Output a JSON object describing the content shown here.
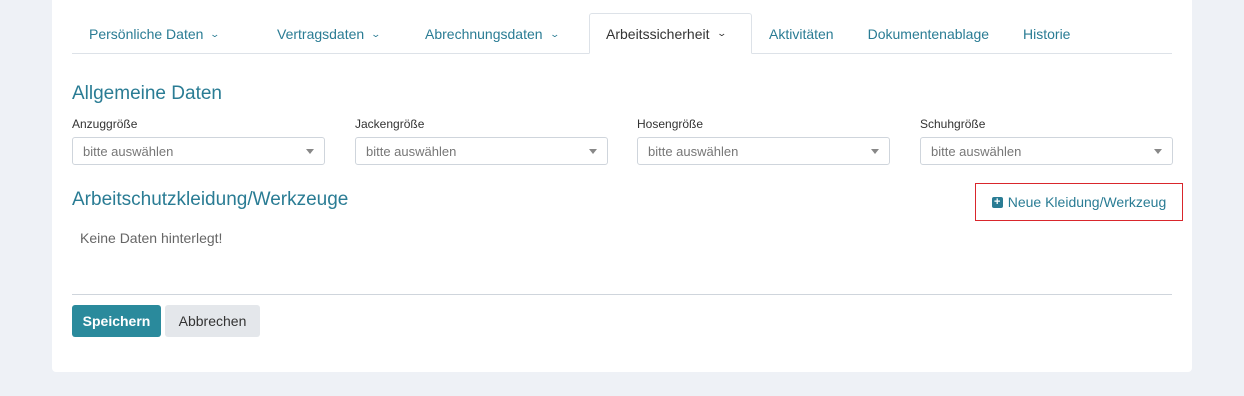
{
  "tabs": [
    {
      "label": "Persönliche Daten",
      "has_dropdown": true,
      "active": false
    },
    {
      "label": "Vertragsdaten",
      "has_dropdown": true,
      "active": false
    },
    {
      "label": "Abrechnungsdaten",
      "has_dropdown": true,
      "active": false
    },
    {
      "label": "Arbeitssicherheit",
      "has_dropdown": true,
      "active": true
    },
    {
      "label": "Aktivitäten",
      "has_dropdown": false,
      "active": false
    },
    {
      "label": "Dokumentenablage",
      "has_dropdown": false,
      "active": false
    },
    {
      "label": "Historie",
      "has_dropdown": false,
      "active": false
    }
  ],
  "general": {
    "title": "Allgemeine Daten",
    "fields": [
      {
        "label": "Anzuggröße",
        "placeholder": "bitte auswählen"
      },
      {
        "label": "Jackengröße",
        "placeholder": "bitte auswählen"
      },
      {
        "label": "Hosengröße",
        "placeholder": "bitte auswählen"
      },
      {
        "label": "Schuhgröße",
        "placeholder": "bitte auswählen"
      }
    ]
  },
  "equipment": {
    "title": "Arbeitschutzkleidung/Werkzeuge",
    "add_label": "Neue Kleidung/Werkzeug",
    "add_icon": "plus-square-icon",
    "empty_text": "Keine Daten hinterlegt!"
  },
  "actions": {
    "save_label": "Speichern",
    "cancel_label": "Abbrechen"
  },
  "colors": {
    "accent": "#2a7c94",
    "primary_button": "#2a8a9c",
    "highlight_border": "#d9262c"
  }
}
